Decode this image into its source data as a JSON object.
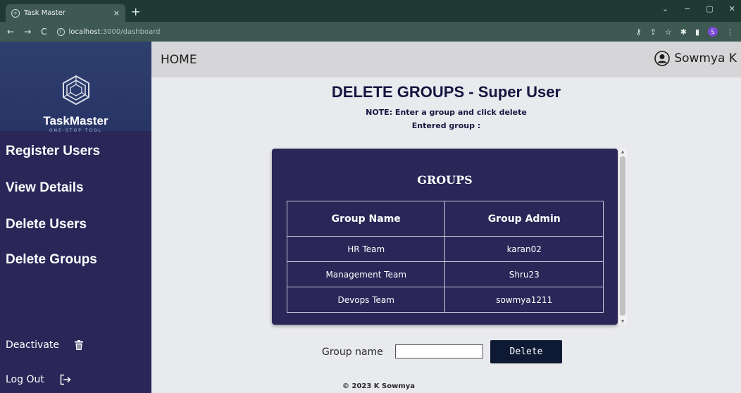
{
  "browser": {
    "tab_title": "Task Master",
    "tab_close": "×",
    "new_tab": "+",
    "url_host": "localhost",
    "url_path": ":3000/dashboard",
    "nav_back": "←",
    "nav_forward": "→",
    "nav_reload": "C",
    "win_min": "−",
    "win_restore": "▢",
    "win_close": "✕",
    "win_dropdown": "⌄",
    "profile_initial": "S"
  },
  "sidebar": {
    "brand_name": "TaskMaster",
    "brand_sub": "ONE-STOP TOOL",
    "items": [
      {
        "label": "Register Users"
      },
      {
        "label": "View Details"
      },
      {
        "label": "Delete Users"
      },
      {
        "label": "Delete Groups"
      }
    ],
    "deactivate_label": "Deactivate",
    "logout_label": "Log Out"
  },
  "header": {
    "home_label": "HOME",
    "user_name": "Sowmya K"
  },
  "main": {
    "title": "DELETE GROUPS - Super User",
    "note": "NOTE: Enter a group and click delete",
    "entered": "Entered group :",
    "card_title": "GROUPS",
    "table": {
      "headers": [
        "Group Name",
        "Group Admin"
      ],
      "rows": [
        [
          "HR Team",
          "karan02"
        ],
        [
          "Management Team",
          "Shru23"
        ],
        [
          "Devops Team",
          "sowmya1211"
        ]
      ]
    },
    "form": {
      "label": "Group name",
      "value": "",
      "button_label": "Delete"
    },
    "footer": "© 2023 K Sowmya"
  }
}
